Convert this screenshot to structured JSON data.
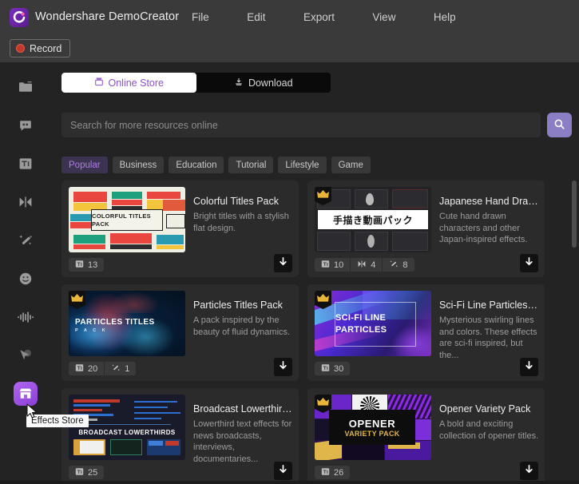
{
  "app": {
    "title": "Wondershare DemoCreator",
    "logo_icon": "democreator-logo-icon",
    "accent": "#a35fe8",
    "menu": [
      {
        "label": "File"
      },
      {
        "label": "Edit"
      },
      {
        "label": "Export"
      },
      {
        "label": "View"
      },
      {
        "label": "Help"
      }
    ],
    "record_label": "Record"
  },
  "rail": {
    "items": [
      {
        "name": "media-library",
        "icon": "folder-icon",
        "active": false
      },
      {
        "name": "captions",
        "icon": "caption-bubble-icon",
        "active": false
      },
      {
        "name": "titles",
        "icon": "text-ti-icon",
        "active": false
      },
      {
        "name": "transitions",
        "icon": "transition-bowtie-icon",
        "active": false
      },
      {
        "name": "effects",
        "icon": "magic-wand-icon",
        "active": false
      },
      {
        "name": "stickers",
        "icon": "sticker-smiley-icon",
        "active": false
      },
      {
        "name": "audio",
        "icon": "audio-waveform-icon",
        "active": false
      },
      {
        "name": "annotations",
        "icon": "cursor-arrow-icon",
        "active": false
      },
      {
        "name": "effects-store",
        "icon": "store-icon",
        "active": true
      }
    ]
  },
  "tooltip": {
    "text": "Effects Store"
  },
  "tabs": [
    {
      "label": "Online Store",
      "icon": "store-bag-icon",
      "active": true
    },
    {
      "label": "Download",
      "icon": "download-tray-icon",
      "active": false
    }
  ],
  "search": {
    "placeholder": "Search for more resources online",
    "value": "",
    "button_icon": "search-icon"
  },
  "chips": [
    {
      "label": "Popular",
      "active": true
    },
    {
      "label": "Business",
      "active": false
    },
    {
      "label": "Education",
      "active": false
    },
    {
      "label": "Tutorial",
      "active": false
    },
    {
      "label": "Lifestyle",
      "active": false
    },
    {
      "label": "Game",
      "active": false
    }
  ],
  "cards": [
    {
      "title": "Colorful Titles Pack",
      "desc": "Bright titles with a stylish flat design.",
      "thumb_text": "COLORFUL TITLES PACK",
      "premium": false,
      "badges": [
        {
          "icon": "text-ti-icon",
          "count": "13"
        }
      ],
      "download_icon": "download-arrow-icon"
    },
    {
      "title": "Japanese Hand Drawn ...",
      "desc": "Cute hand drawn characters and other Japan-inspired effects.",
      "thumb_text": "手描き動画パック",
      "premium": true,
      "badges": [
        {
          "icon": "text-ti-icon",
          "count": "10"
        },
        {
          "icon": "transition-bowtie-icon",
          "count": "4"
        },
        {
          "icon": "magic-wand-icon",
          "count": "8"
        }
      ],
      "download_icon": "download-arrow-icon"
    },
    {
      "title": "Particles Titles Pack",
      "desc": "A pack inspired by the beauty of fluid dynamics.",
      "thumb_text": "PARTICLES TITLES",
      "thumb_sub": "P A C K",
      "premium": true,
      "badges": [
        {
          "icon": "text-ti-icon",
          "count": "20"
        },
        {
          "icon": "magic-wand-icon",
          "count": "1"
        }
      ],
      "download_icon": "download-arrow-icon"
    },
    {
      "title": "Sci-Fi Line Particles Pack",
      "desc": "Mysterious swirling lines and colors. These effects are sci-fi inspired, but the...",
      "thumb_text": "SCI-FI LINE PARTICLES",
      "premium": true,
      "badges": [
        {
          "icon": "text-ti-icon",
          "count": "30"
        }
      ],
      "download_icon": "download-arrow-icon"
    },
    {
      "title": "Broadcast Lowerthirds ...",
      "desc": "Lowerthird text effects for news broadcasts, interviews, documentaries...",
      "thumb_text": "BROADCAST LOWERTHIRDS",
      "premium": false,
      "badges": [
        {
          "icon": "text-ti-icon",
          "count": "25"
        }
      ],
      "download_icon": "download-arrow-icon"
    },
    {
      "title": "Opener Variety Pack",
      "desc": "A bold and exciting collection of opener titles.",
      "thumb_text": "OPENER",
      "thumb_sub": "VARIETY PACK",
      "premium": true,
      "badges": [
        {
          "icon": "text-ti-icon",
          "count": "26"
        }
      ],
      "download_icon": "download-arrow-icon"
    }
  ]
}
